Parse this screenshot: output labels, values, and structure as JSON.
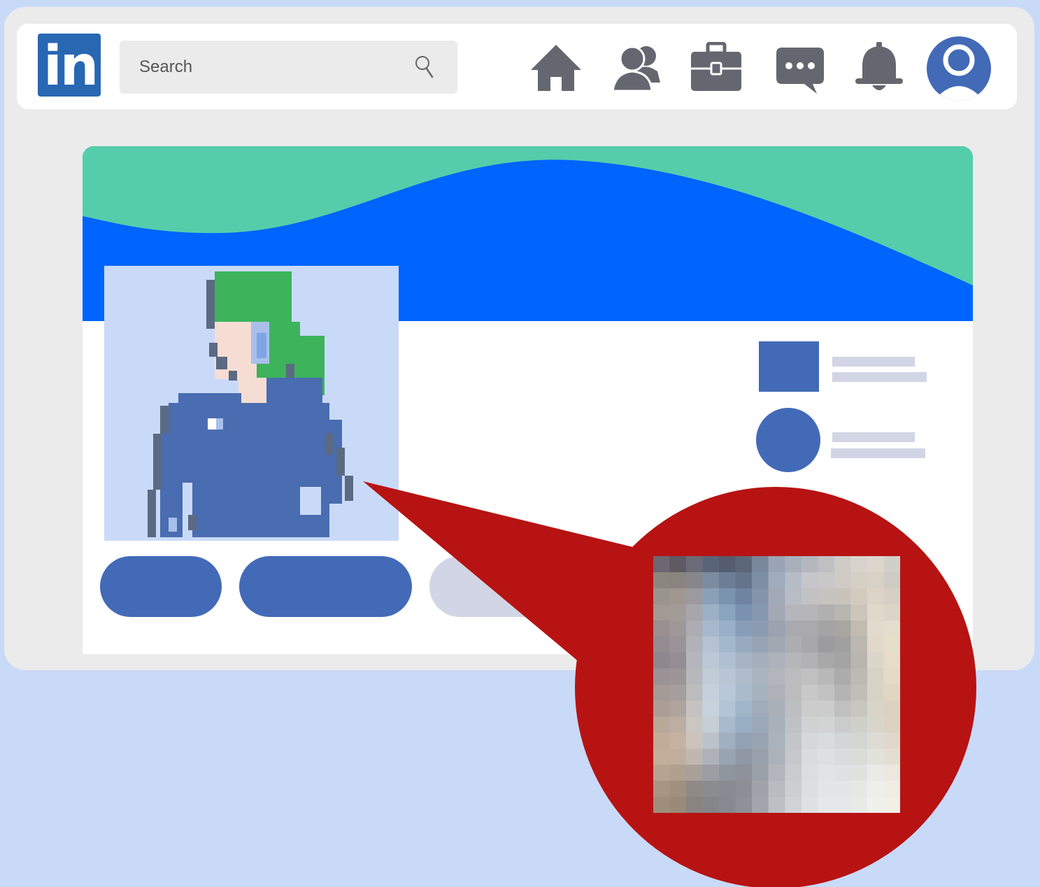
{
  "header": {
    "logo_text": "in",
    "search": {
      "placeholder": "Search",
      "value": ""
    }
  },
  "nav": {
    "icons": [
      "home-icon",
      "network-icon",
      "jobs-icon",
      "messaging-icon",
      "notifications-icon",
      "profile-avatar-icon"
    ]
  },
  "colors": {
    "page_background": "#c9daf9",
    "window_background": "#ebebeb",
    "brand_blue": "#2867b2",
    "icon_gray": "#666670",
    "accent_blue": "#436ab6",
    "banner_green": "#55cdab",
    "banner_blue": "#0064ff",
    "callout_red": "#b71313",
    "placeholder_gray": "#d1d5e5"
  },
  "profile": {
    "photo": "pixelated-avatar-green-hair",
    "action_buttons": [
      "primary-pill",
      "primary-pill",
      "secondary-pill"
    ]
  },
  "callout": {
    "zoom": "pixelated-blurred-photo"
  }
}
